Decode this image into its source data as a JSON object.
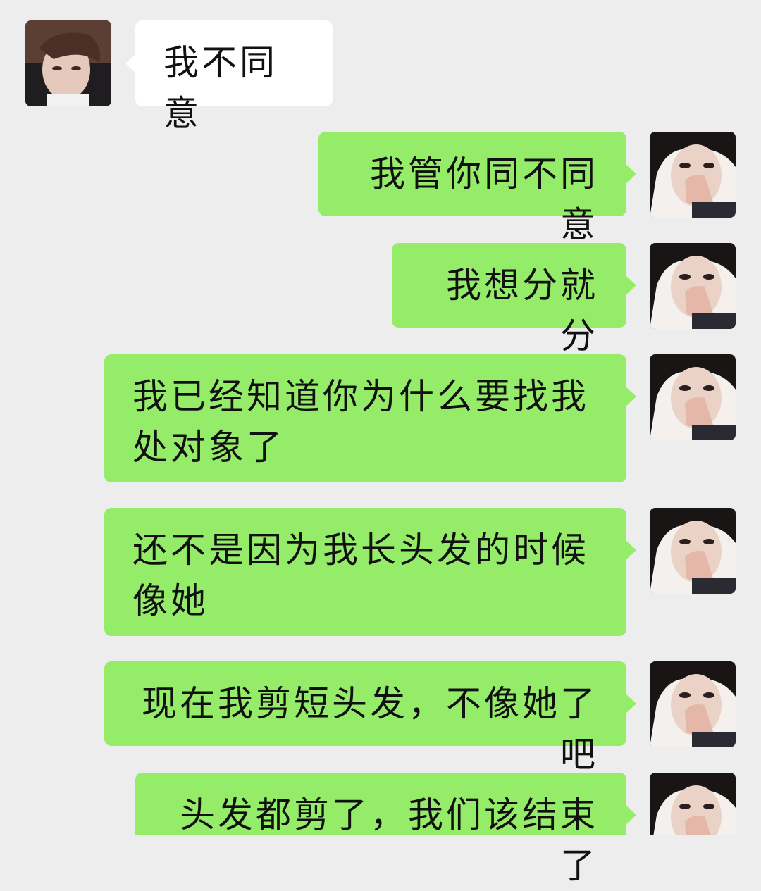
{
  "chat": {
    "contact_avatar_icon": "male-avatar-photo",
    "self_avatar_icon": "female-avatar-photo",
    "colors": {
      "background": "#ededed",
      "incoming_bubble": "#ffffff",
      "outgoing_bubble": "#95ec69"
    },
    "messages": [
      {
        "sender": "contact",
        "text": "我不同意"
      },
      {
        "sender": "self",
        "text": "我管你同不同意"
      },
      {
        "sender": "self",
        "text": "我想分就分"
      },
      {
        "sender": "self",
        "text": "我已经知道你为什么要找我处对象了"
      },
      {
        "sender": "self",
        "text": "还不是因为我长头发的时候像她"
      },
      {
        "sender": "self",
        "text": "现在我剪短头发，不像她了吧"
      },
      {
        "sender": "self",
        "text": "头发都剪了，我们该结束了"
      }
    ]
  }
}
